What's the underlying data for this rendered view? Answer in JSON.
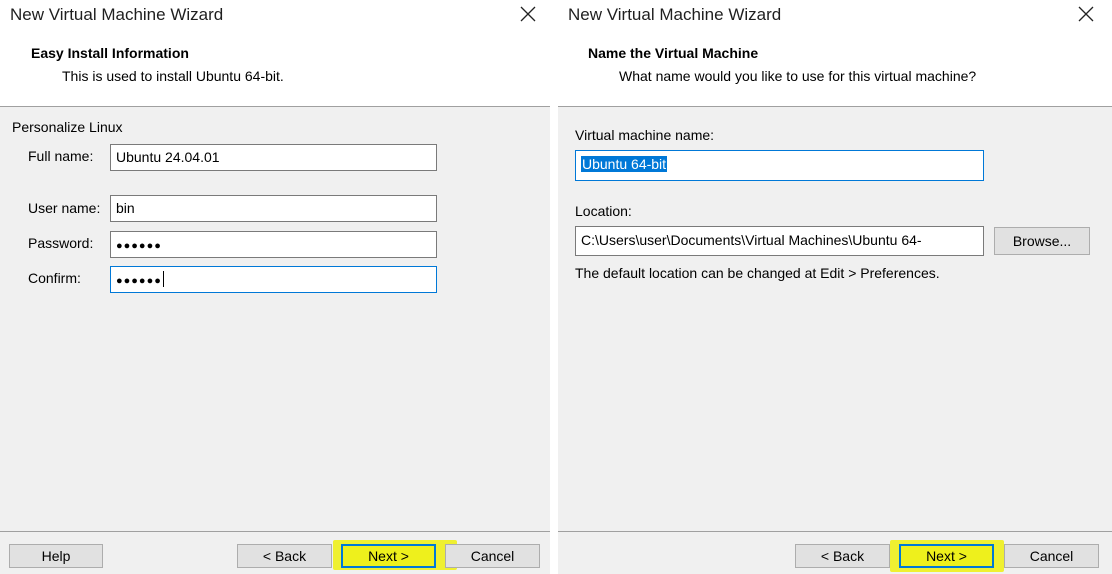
{
  "dialog_left": {
    "title": "New Virtual Machine Wizard",
    "header": {
      "title": "Easy Install Information",
      "subtitle": "This is used to install Ubuntu 64-bit."
    },
    "section_label": "Personalize Linux",
    "fields": {
      "full_name_label": "Full name:",
      "full_name_value": "Ubuntu 24.04.01",
      "user_name_label": "User name:",
      "user_name_value": "bin",
      "password_label": "Password:",
      "password_value": "●●●●●●",
      "confirm_label": "Confirm:",
      "confirm_value": "●●●●●●"
    },
    "buttons": {
      "help": "Help",
      "back": "< Back",
      "next": "Next >",
      "cancel": "Cancel"
    }
  },
  "dialog_right": {
    "title": "New Virtual Machine Wizard",
    "header": {
      "title": "Name the Virtual Machine",
      "subtitle": "What name would you like to use for this virtual machine?"
    },
    "vm_name_label": "Virtual machine name:",
    "vm_name_value": "Ubuntu 64-bit",
    "location_label": "Location:",
    "location_value": "C:\\Users\\user\\Documents\\Virtual Machines\\Ubuntu 64-",
    "browse_button": "Browse...",
    "hint": "The default location can be changed at Edit > Preferences.",
    "buttons": {
      "back": "< Back",
      "next": "Next >",
      "cancel": "Cancel"
    }
  },
  "colors": {
    "highlight": "#eef01c",
    "focus": "#0078d7",
    "dialog_bg": "#f0f0f0"
  }
}
